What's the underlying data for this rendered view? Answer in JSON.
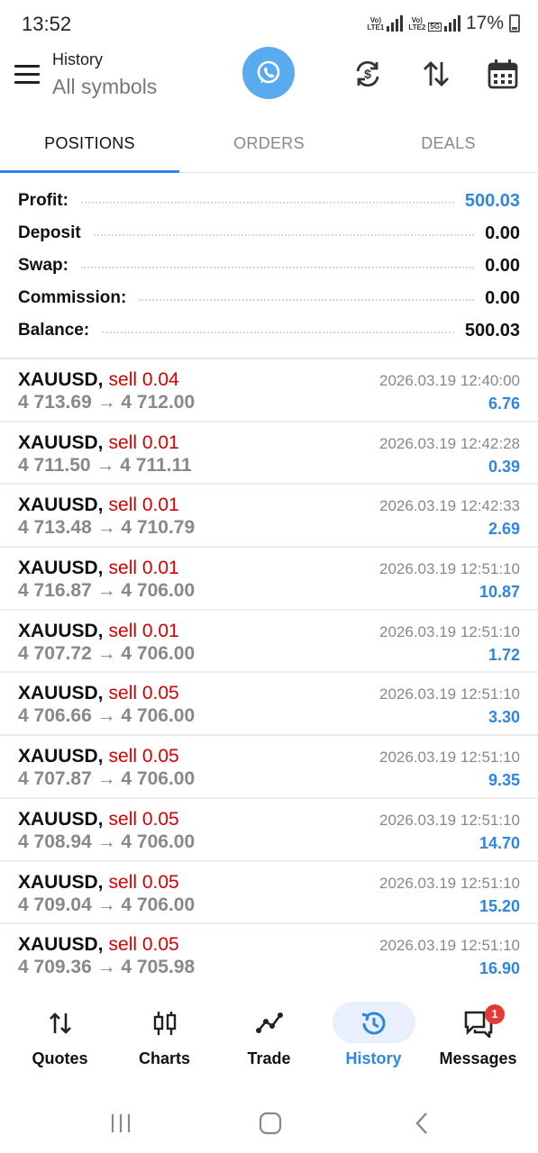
{
  "status_bar": {
    "time": "13:52",
    "sim1_label": "Vo) LTE1",
    "sim2_label": "Vo) LTE2",
    "network": "5G",
    "battery": "17%"
  },
  "header": {
    "title": "History",
    "subtitle": "All symbols",
    "icons": [
      "menu-icon",
      "whatsapp-icon",
      "currency-exchange-icon",
      "sort-icon",
      "calendar-icon"
    ]
  },
  "tabs": [
    {
      "label": "POSITIONS",
      "active": true
    },
    {
      "label": "ORDERS",
      "active": false
    },
    {
      "label": "DEALS",
      "active": false
    }
  ],
  "summary": [
    {
      "label": "Profit:",
      "value": "500.03",
      "highlight": true
    },
    {
      "label": "Deposit",
      "value": "0.00",
      "highlight": false
    },
    {
      "label": "Swap:",
      "value": "0.00",
      "highlight": false
    },
    {
      "label": "Commission:",
      "value": "0.00",
      "highlight": false
    },
    {
      "label": "Balance:",
      "value": "500.03",
      "highlight": false
    }
  ],
  "deals": [
    {
      "symbol": "XAUUSD,",
      "side": "sell 0.04",
      "prices": "4 713.69 → 4 712.00",
      "datetime": "2026.03.19 12:40:00",
      "profit": "6.76"
    },
    {
      "symbol": "XAUUSD,",
      "side": "sell 0.01",
      "prices": "4 711.50 → 4 711.11",
      "datetime": "2026.03.19 12:42:28",
      "profit": "0.39"
    },
    {
      "symbol": "XAUUSD,",
      "side": "sell 0.01",
      "prices": "4 713.48 → 4 710.79",
      "datetime": "2026.03.19 12:42:33",
      "profit": "2.69"
    },
    {
      "symbol": "XAUUSD,",
      "side": "sell 0.01",
      "prices": "4 716.87 → 4 706.00",
      "datetime": "2026.03.19 12:51:10",
      "profit": "10.87"
    },
    {
      "symbol": "XAUUSD,",
      "side": "sell 0.01",
      "prices": "4 707.72 → 4 706.00",
      "datetime": "2026.03.19 12:51:10",
      "profit": "1.72"
    },
    {
      "symbol": "XAUUSD,",
      "side": "sell 0.05",
      "prices": "4 706.66 → 4 706.00",
      "datetime": "2026.03.19 12:51:10",
      "profit": "3.30"
    },
    {
      "symbol": "XAUUSD,",
      "side": "sell 0.05",
      "prices": "4 707.87 → 4 706.00",
      "datetime": "2026.03.19 12:51:10",
      "profit": "9.35"
    },
    {
      "symbol": "XAUUSD,",
      "side": "sell 0.05",
      "prices": "4 708.94 → 4 706.00",
      "datetime": "2026.03.19 12:51:10",
      "profit": "14.70"
    },
    {
      "symbol": "XAUUSD,",
      "side": "sell 0.05",
      "prices": "4 709.04 → 4 706.00",
      "datetime": "2026.03.19 12:51:10",
      "profit": "15.20"
    },
    {
      "symbol": "XAUUSD,",
      "side": "sell 0.05",
      "prices": "4 709.36 → 4 705.98",
      "datetime": "2026.03.19 12:51:10",
      "profit": "16.90"
    }
  ],
  "bottom_nav": [
    {
      "label": "Quotes",
      "icon": "quotes-icon",
      "active": false
    },
    {
      "label": "Charts",
      "icon": "candlestick-icon",
      "active": false
    },
    {
      "label": "Trade",
      "icon": "trend-line-icon",
      "active": false
    },
    {
      "label": "History",
      "icon": "history-icon",
      "active": true
    },
    {
      "label": "Messages",
      "icon": "chat-icon",
      "active": false,
      "badge": "1"
    }
  ],
  "colors": {
    "accent": "#2f86e0",
    "sell": "#d40000",
    "whatsapp_button": "#5aaaf0",
    "badge": "#e53935"
  }
}
